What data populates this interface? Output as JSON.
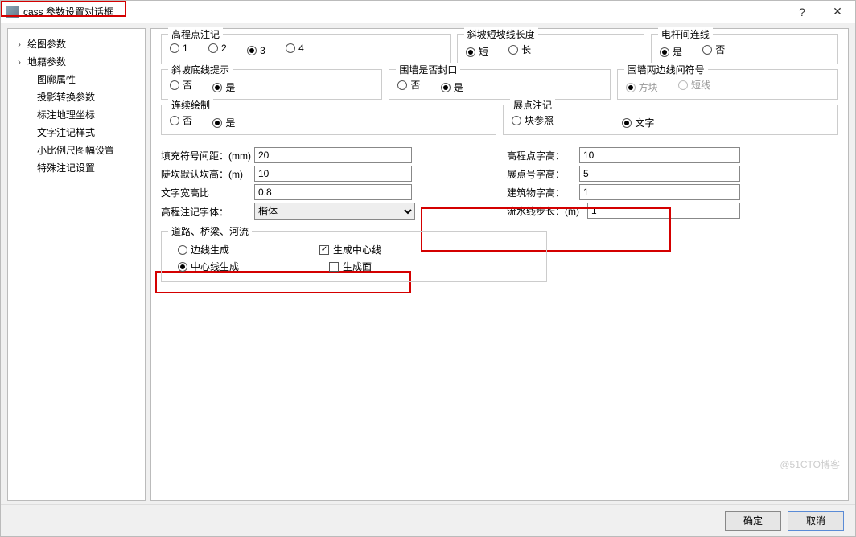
{
  "window": {
    "title": "cass 参数设置对话框",
    "help": "?",
    "close": "✕"
  },
  "sidebar": {
    "items": [
      {
        "label": "绘图参数",
        "expandable": true
      },
      {
        "label": "地籍参数",
        "expandable": true
      },
      {
        "label": "图廓属性",
        "child": true
      },
      {
        "label": "投影转换参数",
        "child": true
      },
      {
        "label": "标注地理坐标",
        "child": true
      },
      {
        "label": "文字注记样式",
        "child": true
      },
      {
        "label": "小比例尺图幅设置",
        "child": true
      },
      {
        "label": "特殊注记设置",
        "child": true
      }
    ]
  },
  "groups": {
    "elev_anno": {
      "title": "高程点注记",
      "options": [
        "1",
        "2",
        "3",
        "4"
      ],
      "selected": "3"
    },
    "slope_len": {
      "title": "斜坡短坡线长度",
      "options": [
        "短",
        "长"
      ],
      "selected": "短"
    },
    "pole_conn": {
      "title": "电杆间连线",
      "options": [
        "是",
        "否"
      ],
      "selected": "是"
    },
    "slope_bottom": {
      "title": "斜坡底线提示",
      "options": [
        "否",
        "是"
      ],
      "selected": "是"
    },
    "wall_seal": {
      "title": "围墙是否封口",
      "options": [
        "否",
        "是"
      ],
      "selected": "是"
    },
    "wall_symbol": {
      "title": "围墙两边线间符号",
      "options": [
        "方块",
        "短线"
      ],
      "selected": "方块",
      "disabled": true
    },
    "cont_draw": {
      "title": "连续绘制",
      "options": [
        "否",
        "是"
      ],
      "selected": "是"
    },
    "exp_anno": {
      "title": "展点注记",
      "options": [
        "块参照",
        "文字"
      ],
      "selected": "文字"
    }
  },
  "fields": {
    "fill_gap": {
      "label": "填充符号间距：(mm)",
      "value": "20"
    },
    "kan_h": {
      "label": "陡坎默认坎高：(m)",
      "value": "10"
    },
    "char_wh": {
      "label": "文字宽高比",
      "value": "0.8"
    },
    "elev_font": {
      "label": "高程注记字体：",
      "value": "楷体"
    },
    "elev_ch": {
      "label": "高程点字高：",
      "value": "10"
    },
    "pt_ch": {
      "label": "展点号字高：",
      "value": "5"
    },
    "bld_ch": {
      "label": "建筑物字高：",
      "value": "1"
    },
    "flow_step": {
      "label": "流水线步长：(m)",
      "value": "1"
    }
  },
  "roads": {
    "title": "道路、桥梁、河流",
    "r1": "边线生成",
    "r2": "中心线生成",
    "c1": "生成中心线",
    "c2": "生成面",
    "r_selected": "中心线生成",
    "c1_checked": true,
    "c2_checked": false
  },
  "footer": {
    "ok": "确定",
    "cancel": "取消"
  },
  "watermark": "@51CTO博客"
}
